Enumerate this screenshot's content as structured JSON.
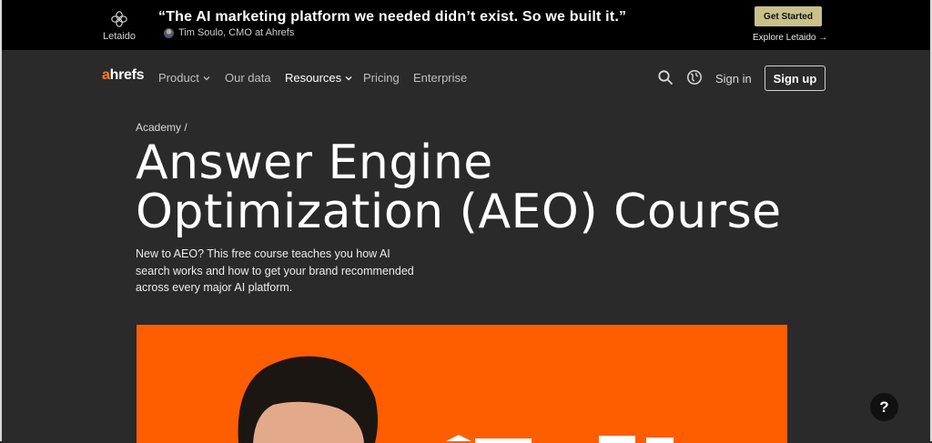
{
  "promo": {
    "brand_name": "Letaido",
    "quote": "“The AI marketing platform we needed didn’t exist. So we built it.”",
    "author": "Tim Soulo, CMO at Ahrefs",
    "cta_label": "Get Started",
    "explore_label": "Explore Letaido →"
  },
  "nav": {
    "brand_first": "a",
    "brand_rest": "hrefs",
    "items": [
      {
        "label": "Product",
        "dropdown": true
      },
      {
        "label": "Our data",
        "dropdown": false
      },
      {
        "label": "Resources",
        "dropdown": true
      },
      {
        "label": "Pricing",
        "dropdown": false
      },
      {
        "label": "Enterprise",
        "dropdown": false
      }
    ],
    "signin_label": "Sign in",
    "signup_label": "Sign up",
    "icons": [
      "search-icon",
      "globe-icon"
    ]
  },
  "hero": {
    "breadcrumb": "Academy /",
    "title_line1": "Answer Engine",
    "title_line2": "Optimization (AEO) Course",
    "lead": "New to AEO? This free course teaches you how AI search works and how to get your brand recommended across every major AI platform."
  },
  "help_label": "?",
  "colors": {
    "page_bg": "#2a2a2a",
    "banner_bg": "#000000",
    "accent_orange": "#ff5e00",
    "cta_bg": "#c9c08a"
  }
}
